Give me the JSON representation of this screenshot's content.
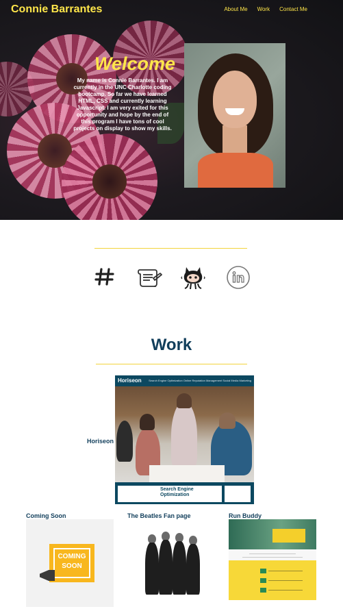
{
  "header": {
    "brand": "Connie Barrantes",
    "nav": [
      "About Me",
      "Work",
      "Contact Me"
    ]
  },
  "hero": {
    "welcome": "Welcome",
    "bio": "My name is Connie Barrantes. I am currently in the UNC Charlotte coding bootcamp. So far we have learned HTML, CSS and currently learning Javascript. I am very exited for this opportunity and hope by the end of this program I have tons of cool projects on display to show my skills."
  },
  "icons": [
    "hashtag-icon",
    "scroll-icon",
    "github-octocat-icon",
    "linkedin-icon"
  ],
  "work": {
    "title": "Work",
    "featured": {
      "label": "Horiseon",
      "logo": "Horiseon",
      "nav": "Search Engine Optimization   Online Reputation Management   Social Media Marketing",
      "card_title": "Search Engine Optimization"
    },
    "projects": [
      {
        "label": "Coming Soon",
        "image_text": "COMING SOON"
      },
      {
        "label": "The Beatles Fan page"
      },
      {
        "label": "Run Buddy"
      }
    ]
  },
  "colors": {
    "accent_yellow": "#ffe64a",
    "heading_blue": "#113e5b",
    "rule_yellow": "#f2d33a"
  }
}
